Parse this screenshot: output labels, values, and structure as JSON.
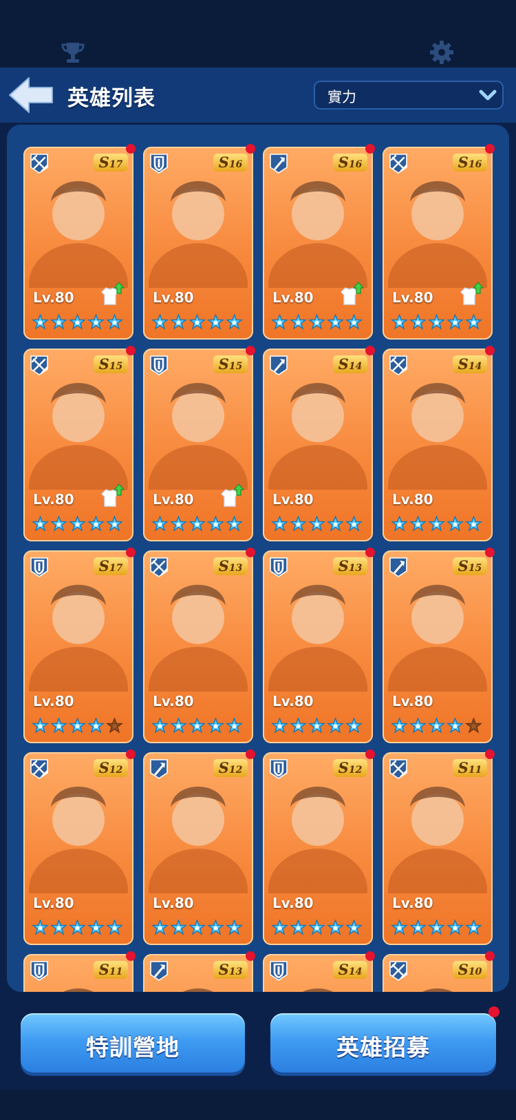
{
  "header": {
    "title": "英雄列表",
    "sort_value": "實力"
  },
  "colors": {
    "card": "#f7893d",
    "star": "#55c9ff",
    "star_empty": "#8a4b20",
    "badge": "#e4132f",
    "button": "#3f9cf2"
  },
  "heroes": [
    {
      "class_icon": "crossbow-icon",
      "grade_letter": "S",
      "grade_num": "17",
      "level": "Lv.80",
      "stars": 5,
      "upgrade": true,
      "red_dot": true
    },
    {
      "class_icon": "shield-icon",
      "grade_letter": "S",
      "grade_num": "16",
      "level": "Lv.80",
      "stars": 5,
      "upgrade": false,
      "red_dot": true
    },
    {
      "class_icon": "staff-icon",
      "grade_letter": "S",
      "grade_num": "16",
      "level": "Lv.80",
      "stars": 5,
      "upgrade": true,
      "red_dot": true
    },
    {
      "class_icon": "crossbow-icon",
      "grade_letter": "S",
      "grade_num": "16",
      "level": "Lv.80",
      "stars": 5,
      "upgrade": true,
      "red_dot": true
    },
    {
      "class_icon": "crossbow-icon",
      "grade_letter": "S",
      "grade_num": "15",
      "level": "Lv.80",
      "stars": 5,
      "upgrade": true,
      "red_dot": true
    },
    {
      "class_icon": "shield-icon",
      "grade_letter": "S",
      "grade_num": "15",
      "level": "Lv.80",
      "stars": 5,
      "upgrade": true,
      "red_dot": true
    },
    {
      "class_icon": "staff-icon",
      "grade_letter": "S",
      "grade_num": "14",
      "level": "Lv.80",
      "stars": 5,
      "upgrade": false,
      "red_dot": true
    },
    {
      "class_icon": "crossbow-icon",
      "grade_letter": "S",
      "grade_num": "14",
      "level": "Lv.80",
      "stars": 5,
      "upgrade": false,
      "red_dot": true
    },
    {
      "class_icon": "shield-icon",
      "grade_letter": "S",
      "grade_num": "17",
      "level": "Lv.80",
      "stars": 4,
      "upgrade": false,
      "red_dot": true
    },
    {
      "class_icon": "crossbow-icon",
      "grade_letter": "S",
      "grade_num": "13",
      "level": "Lv.80",
      "stars": 5,
      "upgrade": false,
      "red_dot": true
    },
    {
      "class_icon": "shield-icon",
      "grade_letter": "S",
      "grade_num": "13",
      "level": "Lv.80",
      "stars": 5,
      "upgrade": false,
      "red_dot": true
    },
    {
      "class_icon": "staff-icon",
      "grade_letter": "S",
      "grade_num": "15",
      "level": "Lv.80",
      "stars": 4,
      "upgrade": false,
      "red_dot": true
    },
    {
      "class_icon": "crossbow-icon",
      "grade_letter": "S",
      "grade_num": "12",
      "level": "Lv.80",
      "stars": 5,
      "upgrade": false,
      "red_dot": true
    },
    {
      "class_icon": "staff-icon",
      "grade_letter": "S",
      "grade_num": "12",
      "level": "Lv.80",
      "stars": 5,
      "upgrade": false,
      "red_dot": true
    },
    {
      "class_icon": "shield-icon",
      "grade_letter": "S",
      "grade_num": "12",
      "level": "Lv.80",
      "stars": 5,
      "upgrade": false,
      "red_dot": true
    },
    {
      "class_icon": "crossbow-icon",
      "grade_letter": "S",
      "grade_num": "11",
      "level": "Lv.80",
      "stars": 5,
      "upgrade": false,
      "red_dot": true
    },
    {
      "class_icon": "shield-icon",
      "grade_letter": "S",
      "grade_num": "11",
      "level": "",
      "stars": 0,
      "upgrade": false,
      "red_dot": true
    },
    {
      "class_icon": "staff-icon",
      "grade_letter": "S",
      "grade_num": "13",
      "level": "",
      "stars": 0,
      "upgrade": false,
      "red_dot": true
    },
    {
      "class_icon": "shield-icon",
      "grade_letter": "S",
      "grade_num": "14",
      "level": "",
      "stars": 0,
      "upgrade": false,
      "red_dot": true
    },
    {
      "class_icon": "crossbow-icon",
      "grade_letter": "S",
      "grade_num": "10",
      "level": "",
      "stars": 0,
      "upgrade": false,
      "red_dot": true
    }
  ],
  "buttons": {
    "training": "特訓營地",
    "recruit": "英雄招募"
  }
}
